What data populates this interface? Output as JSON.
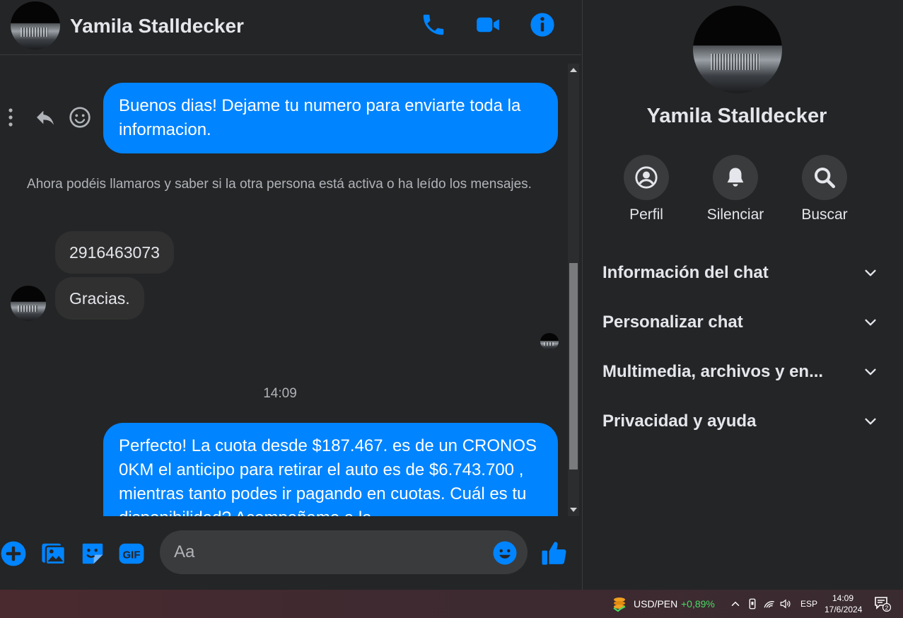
{
  "colors": {
    "accent": "#0084ff",
    "background": "#242526",
    "bubble_other": "#303030",
    "positive": "#4cd964"
  },
  "header": {
    "contact_name": "Yamila Stalldecker",
    "icons": [
      "phone-icon",
      "video-call-icon",
      "info-icon"
    ]
  },
  "messages": {
    "m1": "Buenos dias! Dejame tu numero para enviarte toda la informacion.",
    "system_note": "Ahora podéis llamaros y saber si la otra persona está activa o ha leído los mensajes.",
    "m2": "2916463073",
    "m3": "Gracias.",
    "time_separator": "14:09",
    "m4": "Perfecto! La cuota desde $187.467. es de un CRONOS 0KM el anticipo para retirar el auto es de $6.743.700 , mientras tanto podes ir pagando en cuotas. Cuál es tu disponibilidad? Acompañame a la"
  },
  "composer": {
    "placeholder": "Aa",
    "icons": [
      "plus-icon",
      "image-icon",
      "sticker-icon",
      "gif-icon",
      "emoji-icon",
      "like-icon"
    ]
  },
  "info_panel": {
    "name": "Yamila Stalldecker",
    "actions": [
      {
        "label": "Perfil",
        "icon": "profile-icon"
      },
      {
        "label": "Silenciar",
        "icon": "bell-icon"
      },
      {
        "label": "Buscar",
        "icon": "search-icon"
      }
    ],
    "sections": [
      {
        "label": "Información del chat"
      },
      {
        "label": "Personalizar chat"
      },
      {
        "label": "Multimedia, archivos y en..."
      },
      {
        "label": "Privacidad y ayuda"
      }
    ]
  },
  "taskbar": {
    "ticker": "USD/PEN",
    "change": "+0,89%",
    "language": "ESP",
    "time": "14:09",
    "date": "17/6/2024",
    "notification_count": "2"
  }
}
